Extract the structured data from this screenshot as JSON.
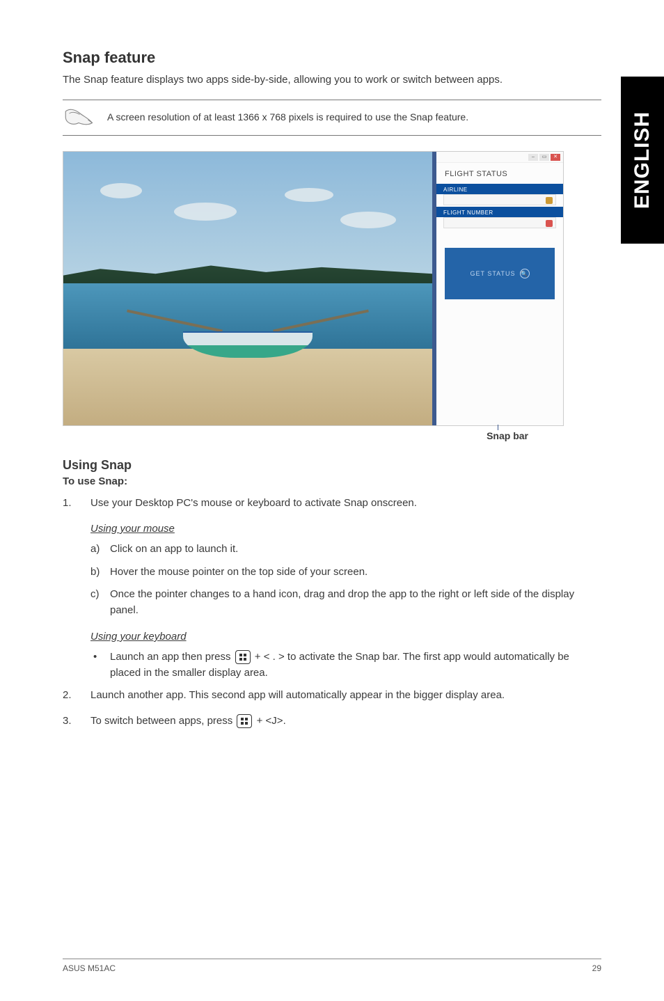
{
  "sideTab": "ENGLISH",
  "section": {
    "title": "Snap feature",
    "intro": "The Snap feature displays two apps side-by-side, allowing you to work or switch between apps."
  },
  "note": {
    "text": "A screen resolution of at least 1366 x 768 pixels is required to use the Snap feature."
  },
  "screenshot": {
    "appTitle": "FLIGHT STATUS",
    "fieldLabel1": "AIRLINE",
    "fieldLabel2": "FLIGHT NUMBER",
    "getStatus": "GET STATUS"
  },
  "snapBarLabel": "Snap bar",
  "usingSnap": {
    "title": "Using Snap",
    "subtitle": "To use Snap:",
    "step1": "Use your Desktop PC's mouse or keyboard to activate Snap onscreen.",
    "mouseTitle": "Using your mouse",
    "mouseA": "Click on an app to launch it.",
    "mouseB": "Hover the mouse pointer on the top side of your screen.",
    "mouseC": "Once the pointer changes to a hand icon, drag and drop the app to the right or left side of the display panel.",
    "keyboardTitle": "Using your keyboard",
    "kbBullet_pre": "Launch an app then press ",
    "kbBullet_post": " + < . > to activate the Snap bar. The first app would automatically be placed in the smaller display area.",
    "step2": "Launch another app. This second app will automatically appear in the bigger display area.",
    "step3_pre": "To switch between apps, press ",
    "step3_post": " + <J>."
  },
  "footer": {
    "left": "ASUS M51AC",
    "right": "29"
  }
}
